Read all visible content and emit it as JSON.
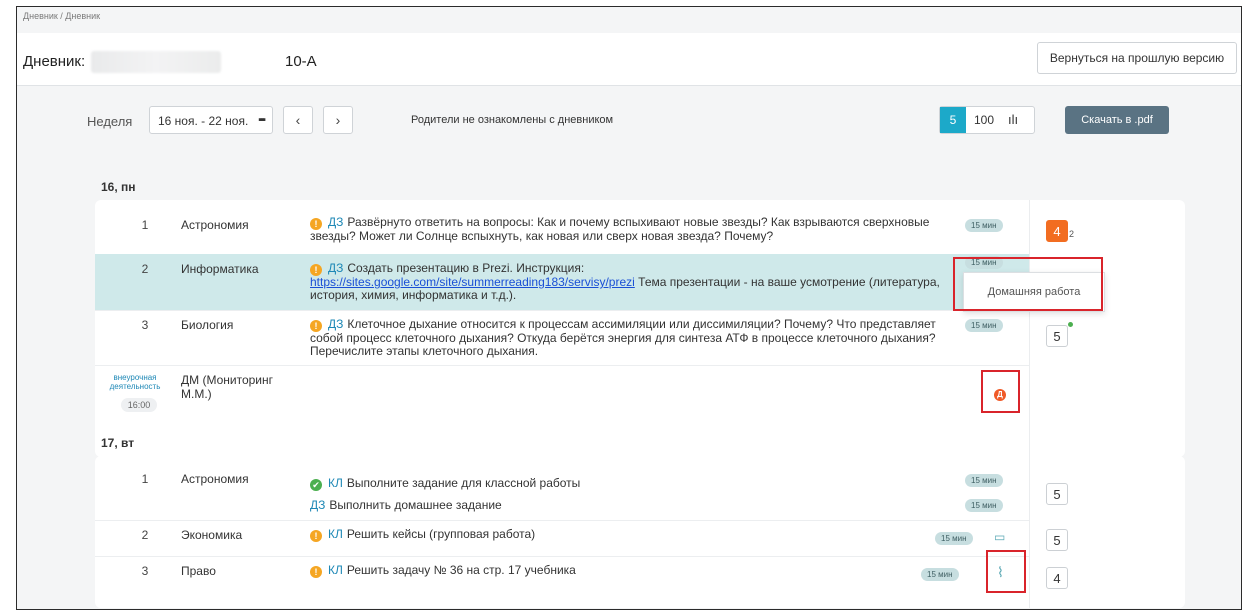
{
  "breadcrumb": "Дневник / Дневник",
  "header": {
    "title": "Дневник:",
    "class_name": "10-А",
    "old_version_button": "Вернуться на прошлую версию"
  },
  "toolbar": {
    "week_label": "Неделя",
    "week_value": "16 ноя. - 22 ноя.",
    "prev": "‹",
    "next": "›",
    "parents_status": "Родители не ознакомлены с дневником",
    "scale_5": "5",
    "scale_100": "100",
    "pdf_button": "Скачать в .pdf"
  },
  "popup": {
    "text": "Домашняя работа"
  },
  "days": [
    {
      "label": "16, пн",
      "lessons": [
        {
          "num": "1",
          "subject": "Астрономия",
          "tag": "ДЗ",
          "text": "Развёрнуто ответить на вопросы: Как и почему вспыхивают новые звезды? Как взрываются сверхновые звезды? Может ли Солнце вспыхнуть, как новая или сверх новая звезда? Почему?",
          "duration": "15 мин",
          "grade": "4",
          "grade_sub": "2"
        },
        {
          "num": "2",
          "subject": "Информатика",
          "tag": "ДЗ",
          "text_before": "Создать презентацию в Prezi. Инструкция:",
          "link": "https://sites.google.com/site/summerreading183/servisy/prezi",
          "text_after": "Тема презентации - на ваше усмотрение (литература, история, химия, информатика и т.д.).",
          "duration": "15 мин"
        },
        {
          "num": "3",
          "subject": "Биология",
          "tag": "ДЗ",
          "text": "Клеточное дыхание относится к процессам ассимиляции или диссимиляции? Почему? Что представляет собой процесс клеточного дыхания? Откуда берётся энергия для синтеза АТФ в процессе клеточного дыхания? Перечислите этапы клеточного дыхания.",
          "duration": "15 мин",
          "grade": "5"
        },
        {
          "extra_label": "внеурочная деятельность",
          "time": "16:00",
          "subject": "ДМ (Мониторинг М.М.)",
          "badge": "Д"
        }
      ]
    },
    {
      "label": "17, вт",
      "lessons": [
        {
          "num": "1",
          "subject": "Астрономия",
          "tag1": "КЛ",
          "text1": "Выполните задание для классной работы",
          "tag2": "ДЗ",
          "text2": "Выполнить домашнее задание",
          "duration1": "15 мин",
          "duration2": "15 мин",
          "grade": "5"
        },
        {
          "num": "2",
          "subject": "Экономика",
          "tag": "КЛ",
          "text": "Решить кейсы (групповая работа)",
          "duration": "15 мин",
          "grade": "5"
        },
        {
          "num": "3",
          "subject": "Право",
          "tag": "КЛ",
          "text": "Решить задачу № 36 на стр. 17 учебника",
          "duration": "15 мин",
          "grade": "4"
        }
      ]
    }
  ],
  "icons": {
    "warn": "!",
    "ok": "✔",
    "comment": "comment-icon",
    "attach": "paperclip-icon",
    "calendar": "calendar-grid-icon",
    "chart": "bar-chart-icon"
  },
  "colors": {
    "accent": "#1ca9c9",
    "pdf_button": "#5a7383",
    "highlight_row": "#cfe9ea",
    "warn": "#f5a623",
    "ok": "#4caf50",
    "grade_orange": "#f26d21",
    "red_box": "#d9242b"
  }
}
